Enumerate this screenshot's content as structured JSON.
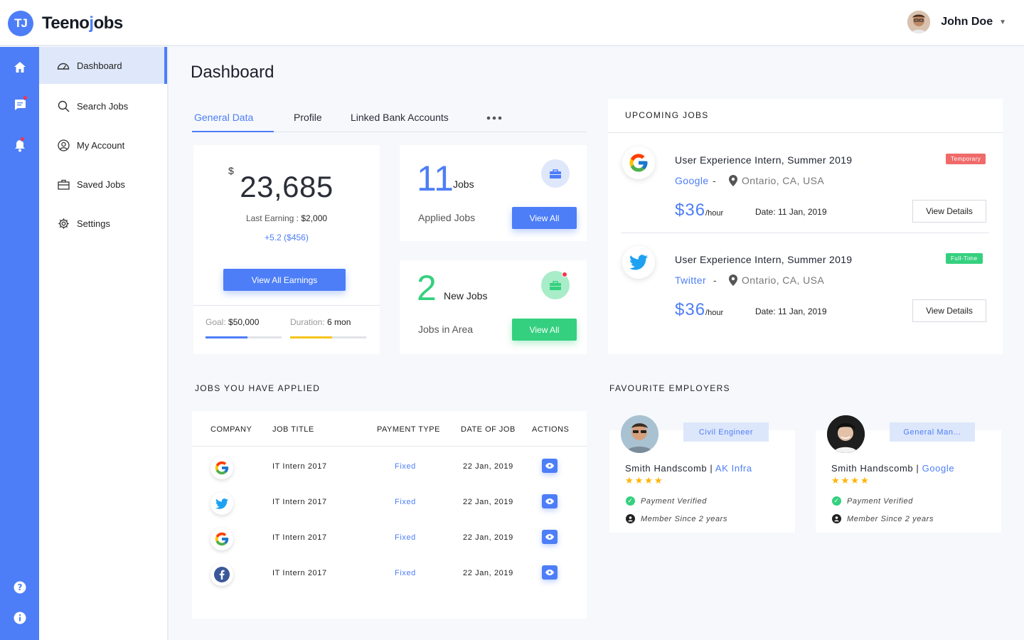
{
  "app": {
    "logo_mark": "TJ",
    "name_part1": "Teeno",
    "name_accent": "j",
    "name_part2": "obs"
  },
  "user": {
    "name": "John Doe"
  },
  "menu": [
    {
      "label": "Dashboard",
      "icon": "dashboard-icon"
    },
    {
      "label": "Search Jobs",
      "icon": "search-icon"
    },
    {
      "label": "My Account",
      "icon": "account-icon"
    },
    {
      "label": "Saved Jobs",
      "icon": "briefcase-icon"
    },
    {
      "label": "Settings",
      "icon": "gear-icon"
    }
  ],
  "page_title": "Dashboard",
  "tabs": [
    "General Data",
    "Profile",
    "Linked Bank Accounts"
  ],
  "earnings": {
    "currency": "$",
    "amount": "23,685",
    "last_label": "Last Earning : ",
    "last_value": "$2,000",
    "delta": "+5.2 ($456)",
    "button": "View All Earnings",
    "goal_label": "Goal: ",
    "goal_value": "$50,000",
    "goal_progress": 0.55,
    "duration_label": "Duration: ",
    "duration_value": "6 mon",
    "duration_progress": 0.55
  },
  "applied_stat": {
    "number": "11",
    "unit": "Jobs",
    "label": "Applied Jobs",
    "button": "View All"
  },
  "new_stat": {
    "number": "2",
    "unit": "New Jobs",
    "label": "Jobs in Area",
    "button": "View All"
  },
  "upcoming": {
    "title": "UPCOMING JOBS",
    "items": [
      {
        "title": "User Experience Intern, Summer 2019",
        "company": "Google",
        "location": "Ontario, CA, USA",
        "rate": "$36",
        "rate_unit": "/hour",
        "date": "Date: 11 Jan, 2019",
        "badge": "Temporary",
        "button": "View Details"
      },
      {
        "title": "User Experience Intern, Summer 2019",
        "company": "Twitter",
        "location": "Ontario, CA, USA",
        "rate": "$36",
        "rate_unit": "/hour",
        "date": "Date: 11 Jan, 2019",
        "badge": "Full-Time",
        "button": "View Details"
      }
    ]
  },
  "applied": {
    "title": "JOBS YOU HAVE APPLIED",
    "columns": [
      "COMPANY",
      "JOB TITLE",
      "PAYMENT TYPE",
      "DATE OF JOB",
      "ACTIONS"
    ],
    "rows": [
      {
        "company_icon": "google-logo",
        "job": "IT Intern 2017",
        "payment": "Fixed",
        "date": "22 Jan, 2019"
      },
      {
        "company_icon": "twitter-logo",
        "job": "IT Intern 2017",
        "payment": "Fixed",
        "date": "22 Jan, 2019"
      },
      {
        "company_icon": "google-logo",
        "job": "IT Intern 2017",
        "payment": "Fixed",
        "date": "22 Jan, 2019"
      },
      {
        "company_icon": "facebook-logo",
        "job": "IT Intern 2017",
        "payment": "Fixed",
        "date": "22 Jan, 2019"
      }
    ]
  },
  "employers": {
    "title": "FAVOURITE EMPLOYERS",
    "items": [
      {
        "role": "Civil Engineer",
        "name": "Smith Handscomb",
        "sep": " | ",
        "company": "AK Infra",
        "stars": "★★★★",
        "verified": "Payment Verified",
        "member": "Member Since 2 years"
      },
      {
        "role": "General Man...",
        "name": "Smith Handscomb",
        "sep": " | ",
        "company": "Google",
        "stars": "★★★★",
        "verified": "Payment Verified",
        "member": "Member Since 2 years"
      }
    ]
  },
  "colors": {
    "primary": "#4d7ef7",
    "green": "#35d07f",
    "red_badge": "#f06a6a",
    "yellow": "#f5c518"
  }
}
